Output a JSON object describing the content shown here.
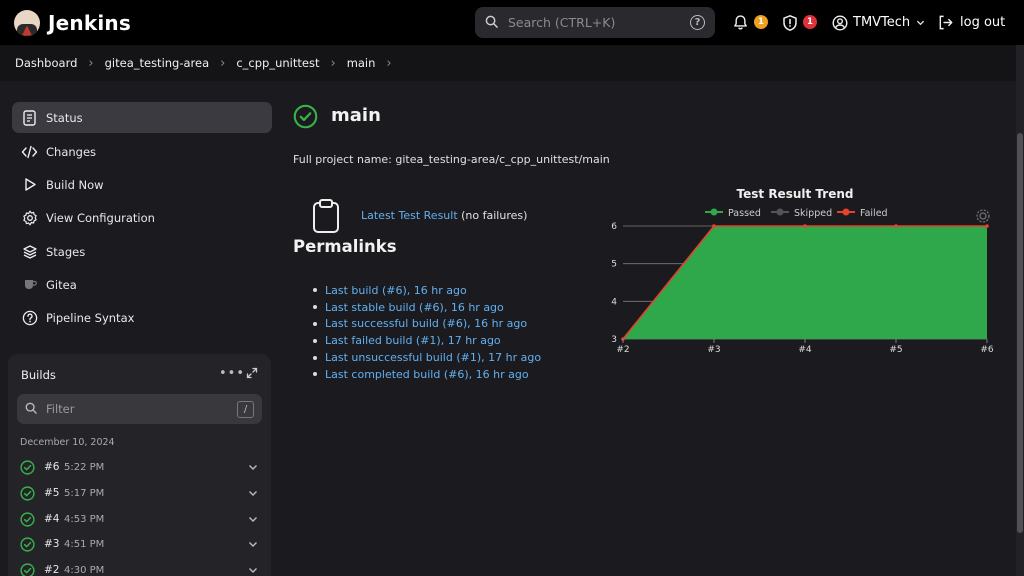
{
  "header": {
    "brand": "Jenkins",
    "search_placeholder": "Search (CTRL+K)",
    "notifications_count": "1",
    "security_count": "1",
    "user": "TMVTech",
    "logout": "log out"
  },
  "breadcrumbs": [
    "Dashboard",
    "gitea_testing-area",
    "c_cpp_unittest",
    "main"
  ],
  "sidebar": {
    "items": [
      {
        "label": "Status",
        "icon": "status-icon"
      },
      {
        "label": "Changes",
        "icon": "code-icon"
      },
      {
        "label": "Build Now",
        "icon": "play-icon"
      },
      {
        "label": "View Configuration",
        "icon": "gear-icon"
      },
      {
        "label": "Stages",
        "icon": "stages-icon"
      },
      {
        "label": "Gitea",
        "icon": "gitea-icon"
      },
      {
        "label": "Pipeline Syntax",
        "icon": "help-icon"
      }
    ]
  },
  "builds": {
    "title": "Builds",
    "filter_placeholder": "Filter",
    "filter_shortcut": "/",
    "date": "December 10, 2024",
    "rows": [
      {
        "num": "#6",
        "time": "5:22 PM"
      },
      {
        "num": "#5",
        "time": "5:17 PM"
      },
      {
        "num": "#4",
        "time": "4:53 PM"
      },
      {
        "num": "#3",
        "time": "4:51 PM"
      },
      {
        "num": "#2",
        "time": "4:30 PM"
      }
    ]
  },
  "main": {
    "title": "main",
    "full_name": "Full project name: gitea_testing-area/c_cpp_unittest/main",
    "latest_test_link": "Latest Test Result",
    "latest_test_note": " (no failures)",
    "permalinks_heading": "Permalinks",
    "permalinks": [
      "Last build (#6), 16 hr ago",
      "Last stable build (#6), 16 hr ago",
      "Last successful build (#6), 16 hr ago",
      "Last failed build (#1), 17 hr ago",
      "Last unsuccessful build (#1), 17 hr ago",
      "Last completed build (#6), 16 hr ago"
    ]
  },
  "colors": {
    "passed": "#2ea84a",
    "skipped": "#555555",
    "failed": "#e8412c",
    "link": "#62b0f0",
    "success_check": "#38b24a"
  },
  "chart_data": {
    "type": "area",
    "title": "Test Result Trend",
    "categories": [
      "#2",
      "#3",
      "#4",
      "#5",
      "#6"
    ],
    "series": [
      {
        "name": "Passed",
        "values": [
          3,
          6,
          6,
          6,
          6
        ]
      },
      {
        "name": "Skipped",
        "values": [
          0,
          0,
          0,
          0,
          0
        ]
      },
      {
        "name": "Failed",
        "values": [
          0,
          0,
          0,
          0,
          0
        ]
      }
    ],
    "ylim": [
      3,
      6
    ],
    "yticks": [
      3,
      4,
      5,
      6
    ],
    "legend": "top",
    "grid": true
  }
}
